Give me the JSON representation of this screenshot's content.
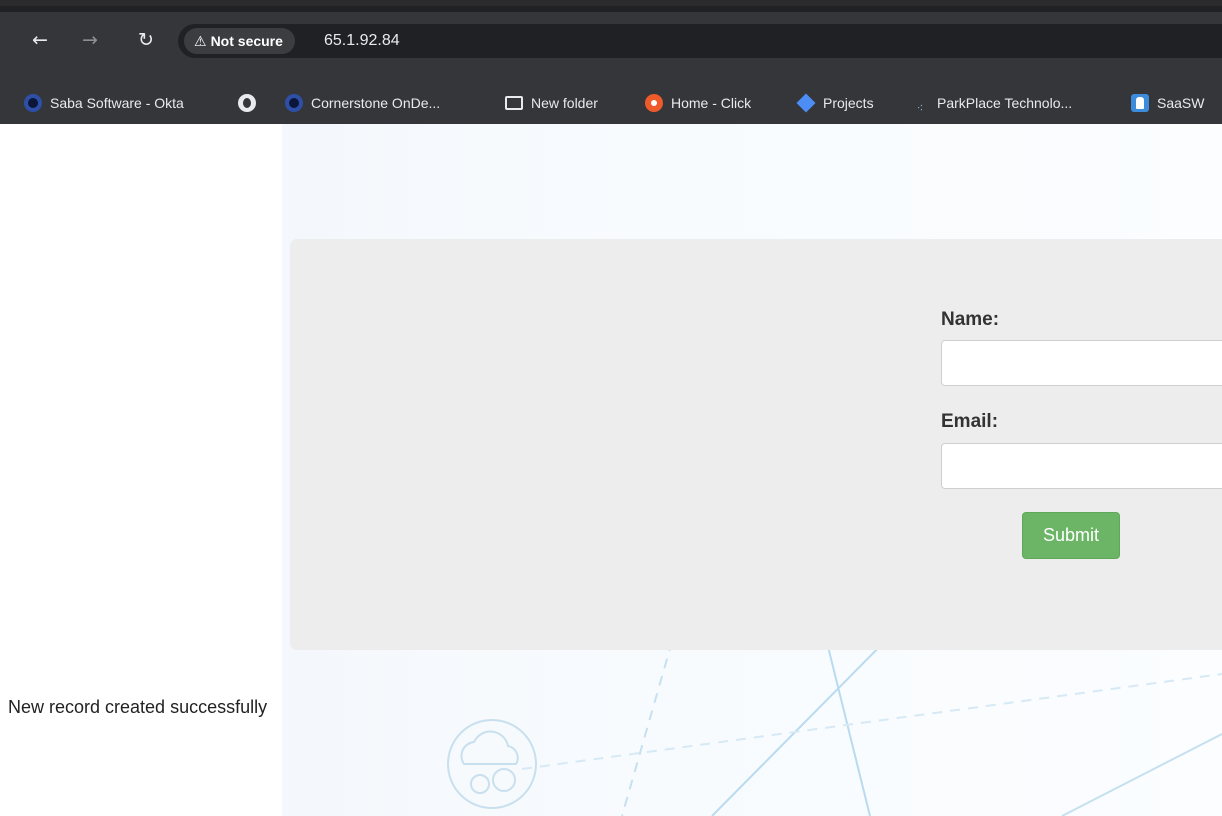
{
  "browser": {
    "back_icon": "arrow-left",
    "forward_icon": "arrow-right",
    "reload_icon": "reload",
    "security_warning": "Not secure",
    "url": "65.1.92.84",
    "bookmarks": [
      {
        "label": "Saba Software - Okta",
        "icon": "okta-ring-icon"
      },
      {
        "label": "",
        "icon": "globe-icon"
      },
      {
        "label": "Cornerstone OnDe...",
        "icon": "okta-ring-icon"
      },
      {
        "label": "New folder",
        "icon": "folder-icon"
      },
      {
        "label": "Home - Click",
        "icon": "clickup-icon"
      },
      {
        "label": "Projects",
        "icon": "jira-diamond-icon"
      },
      {
        "label": "ParkPlace Technolo...",
        "icon": "parkplace-icon"
      },
      {
        "label": "SaaSW",
        "icon": "saasw-icon"
      }
    ]
  },
  "form": {
    "name_label": "Name:",
    "name_value": "",
    "email_label": "Email:",
    "email_value": "",
    "submit_label": "Submit"
  },
  "status": {
    "message": "New record created successfully"
  },
  "colors": {
    "chrome_dark": "#35363a",
    "card_bg": "#ededed",
    "submit_green": "#6cb567"
  }
}
